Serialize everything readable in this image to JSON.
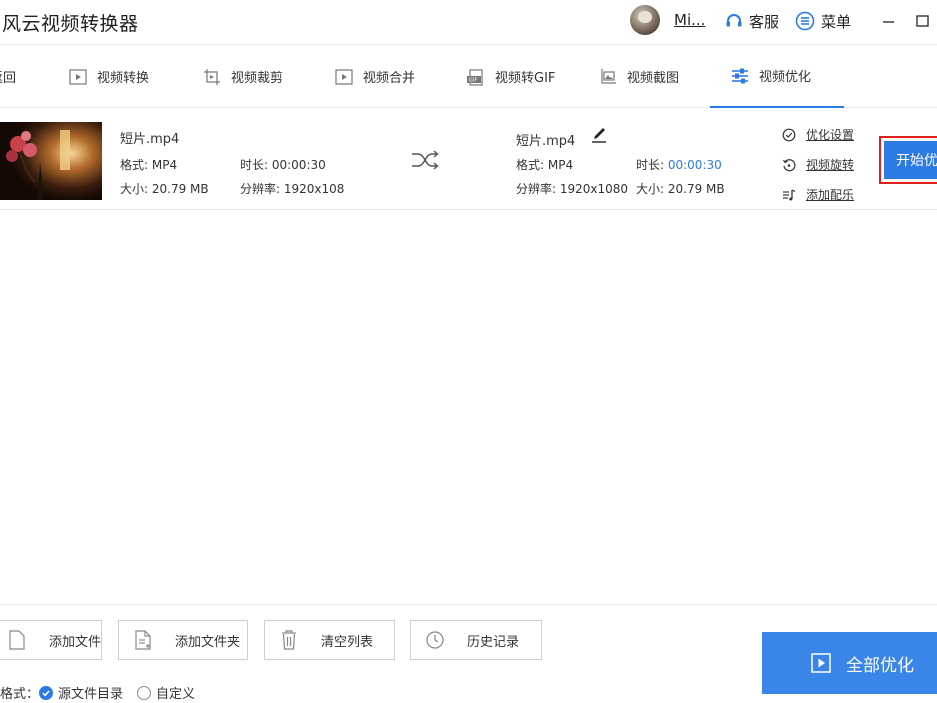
{
  "app": {
    "title": "风云视频转换器",
    "user_name": "Mi...",
    "customer_service": "客服",
    "menu": "菜单"
  },
  "nav": {
    "back": "返回",
    "items": [
      {
        "label": "视频转换",
        "icon": "video-convert-icon"
      },
      {
        "label": "视频裁剪",
        "icon": "video-crop-icon"
      },
      {
        "label": "视频合并",
        "icon": "video-merge-icon"
      },
      {
        "label": "视频转GIF",
        "icon": "gif-icon"
      },
      {
        "label": "视频截图",
        "icon": "screenshot-icon"
      },
      {
        "label": "视频优化",
        "icon": "sliders-icon"
      }
    ],
    "active_index": 5
  },
  "file": {
    "source": {
      "name": "短片.mp4",
      "format": "格式: MP4",
      "duration": "时长: 00:00:30",
      "size": "大小: 20.79 MB",
      "resolution": "分辨率: 1920x108"
    },
    "output": {
      "name": "短片.mp4",
      "format": "格式: MP4",
      "duration_label": "时长: ",
      "duration_value": "00:00:30",
      "resolution": "分辨率: 1920x1080",
      "size": "大小: 20.79 MB"
    },
    "options": {
      "optimize_settings": "优化设置",
      "rotate": "视频旋转",
      "add_music": "添加配乐"
    },
    "start_button": "开始优化"
  },
  "bottom": {
    "add_file": "添加文件",
    "add_folder": "添加文件夹",
    "clear_list": "清空列表",
    "history": "历史记录",
    "output_format_label": "格式：",
    "radio_source": "源文件目录",
    "radio_custom": "自定义",
    "all_optimize": "全部优化"
  },
  "colors": {
    "accent": "#2c7be5",
    "highlight_border": "#e02020"
  }
}
